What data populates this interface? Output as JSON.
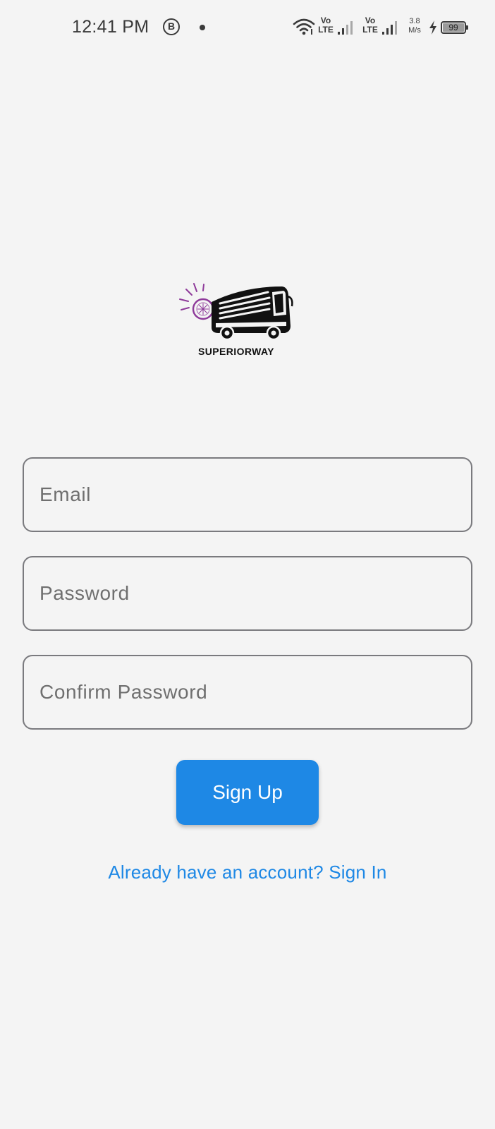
{
  "status_bar": {
    "time": "12:41 PM",
    "b_badge": "B",
    "volte_1": "Vo\nLTE",
    "volte_2": "Vo\nLTE",
    "speed": "3.8\nM/s",
    "battery_percent": "99",
    "battery_level": 0.99,
    "icons": [
      "b-circle-icon",
      "notification-dot-icon",
      "wifi-icon",
      "signal-icon",
      "charging-icon",
      "battery-icon"
    ]
  },
  "logo": {
    "text": "SUPERIORWAY",
    "accent_color": "#8e3a9a"
  },
  "form": {
    "email_placeholder": "Email",
    "password_placeholder": "Password",
    "confirm_placeholder": "Confirm Password",
    "signup_label": "Sign Up",
    "signin_link": "Already have an account? Sign In"
  },
  "colors": {
    "background": "#f4f4f4",
    "primary": "#1e88e5",
    "field_border": "#7a7a7e"
  }
}
